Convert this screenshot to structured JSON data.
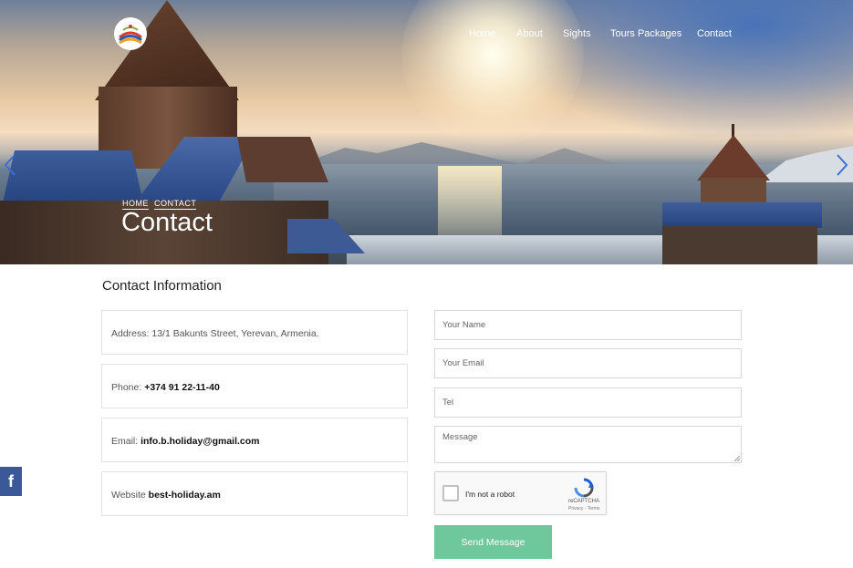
{
  "header": {
    "logo": "Armenia logo",
    "nav": [
      {
        "label": "Home"
      },
      {
        "label": "About"
      },
      {
        "label": "Sights"
      },
      {
        "label": "Tours Packages"
      },
      {
        "label": "Contact"
      }
    ],
    "breadcrumb": [
      "HOME",
      "CONTACT"
    ],
    "title": "Contact"
  },
  "contact": {
    "section_title": "Contact Information",
    "address_label": "Address: 13/1 Bakunts Street, Yerevan, Armenia.",
    "phone_label": "Phone: ",
    "phone_value": "+374 91 22-11-40",
    "email_label": "Email: ",
    "email_value": "info.b.holiday@gmail.com",
    "website_label": "Website ",
    "website_value": "best-holiday.am"
  },
  "form": {
    "name_placeholder": "Your Name",
    "email_placeholder": "Your Email",
    "tel_placeholder": "Tel",
    "message_placeholder": "Message",
    "captcha_text": "I'm not a robot",
    "captcha_brand": "reCAPTCHA",
    "captcha_terms": "Privacy - Terms",
    "send_label": "Send Message"
  },
  "social": {
    "facebook": "f"
  },
  "colors": {
    "send_button": "#6ec89b",
    "facebook": "#3b5998"
  },
  "icons": {
    "left_arrow": "chevron-left-icon",
    "right_arrow": "chevron-right-icon",
    "facebook": "facebook-icon",
    "recaptcha": "recaptcha-icon"
  }
}
